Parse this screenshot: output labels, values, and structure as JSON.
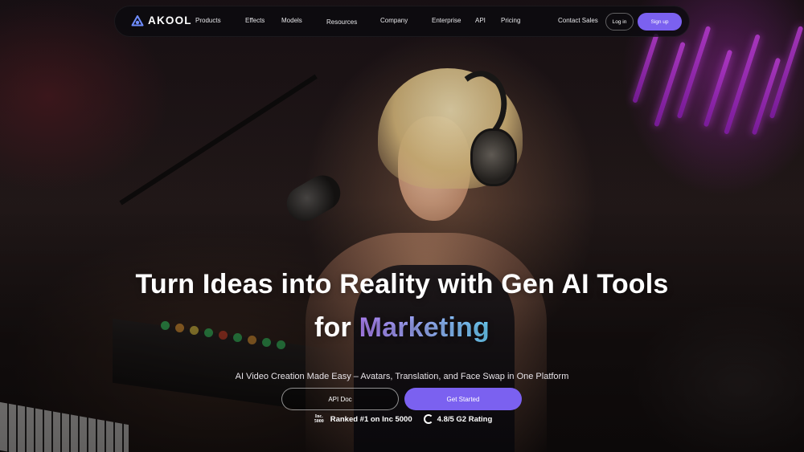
{
  "brand": {
    "name": "AKOOL",
    "accent": "#7b61f0"
  },
  "nav": {
    "items": [
      {
        "label": "Products"
      },
      {
        "label": "Effects"
      },
      {
        "label": "Models"
      },
      {
        "label": "Resources"
      },
      {
        "label": "Company"
      },
      {
        "label": "Enterprise"
      },
      {
        "label": "API"
      },
      {
        "label": "Pricing"
      },
      {
        "label": "Contact Sales"
      }
    ],
    "login_label": "Log in",
    "signup_label": "Sign up"
  },
  "hero": {
    "headline_line1": "Turn Ideas into Reality with Gen AI Tools",
    "headline_for": "for ",
    "headline_accent": "Marketing",
    "subtitle": "AI Video Creation Made Easy – Avatars, Translation, and Face Swap in One Platform",
    "api_doc_label": "API Doc",
    "get_started_label": "Get Started"
  },
  "badges": {
    "inc_icon_text": "Inc. 5000",
    "inc_text": "Ranked #1 on Inc 5000",
    "g2_icon": "g2-icon",
    "g2_text": "4.8/5 G2 Rating"
  }
}
